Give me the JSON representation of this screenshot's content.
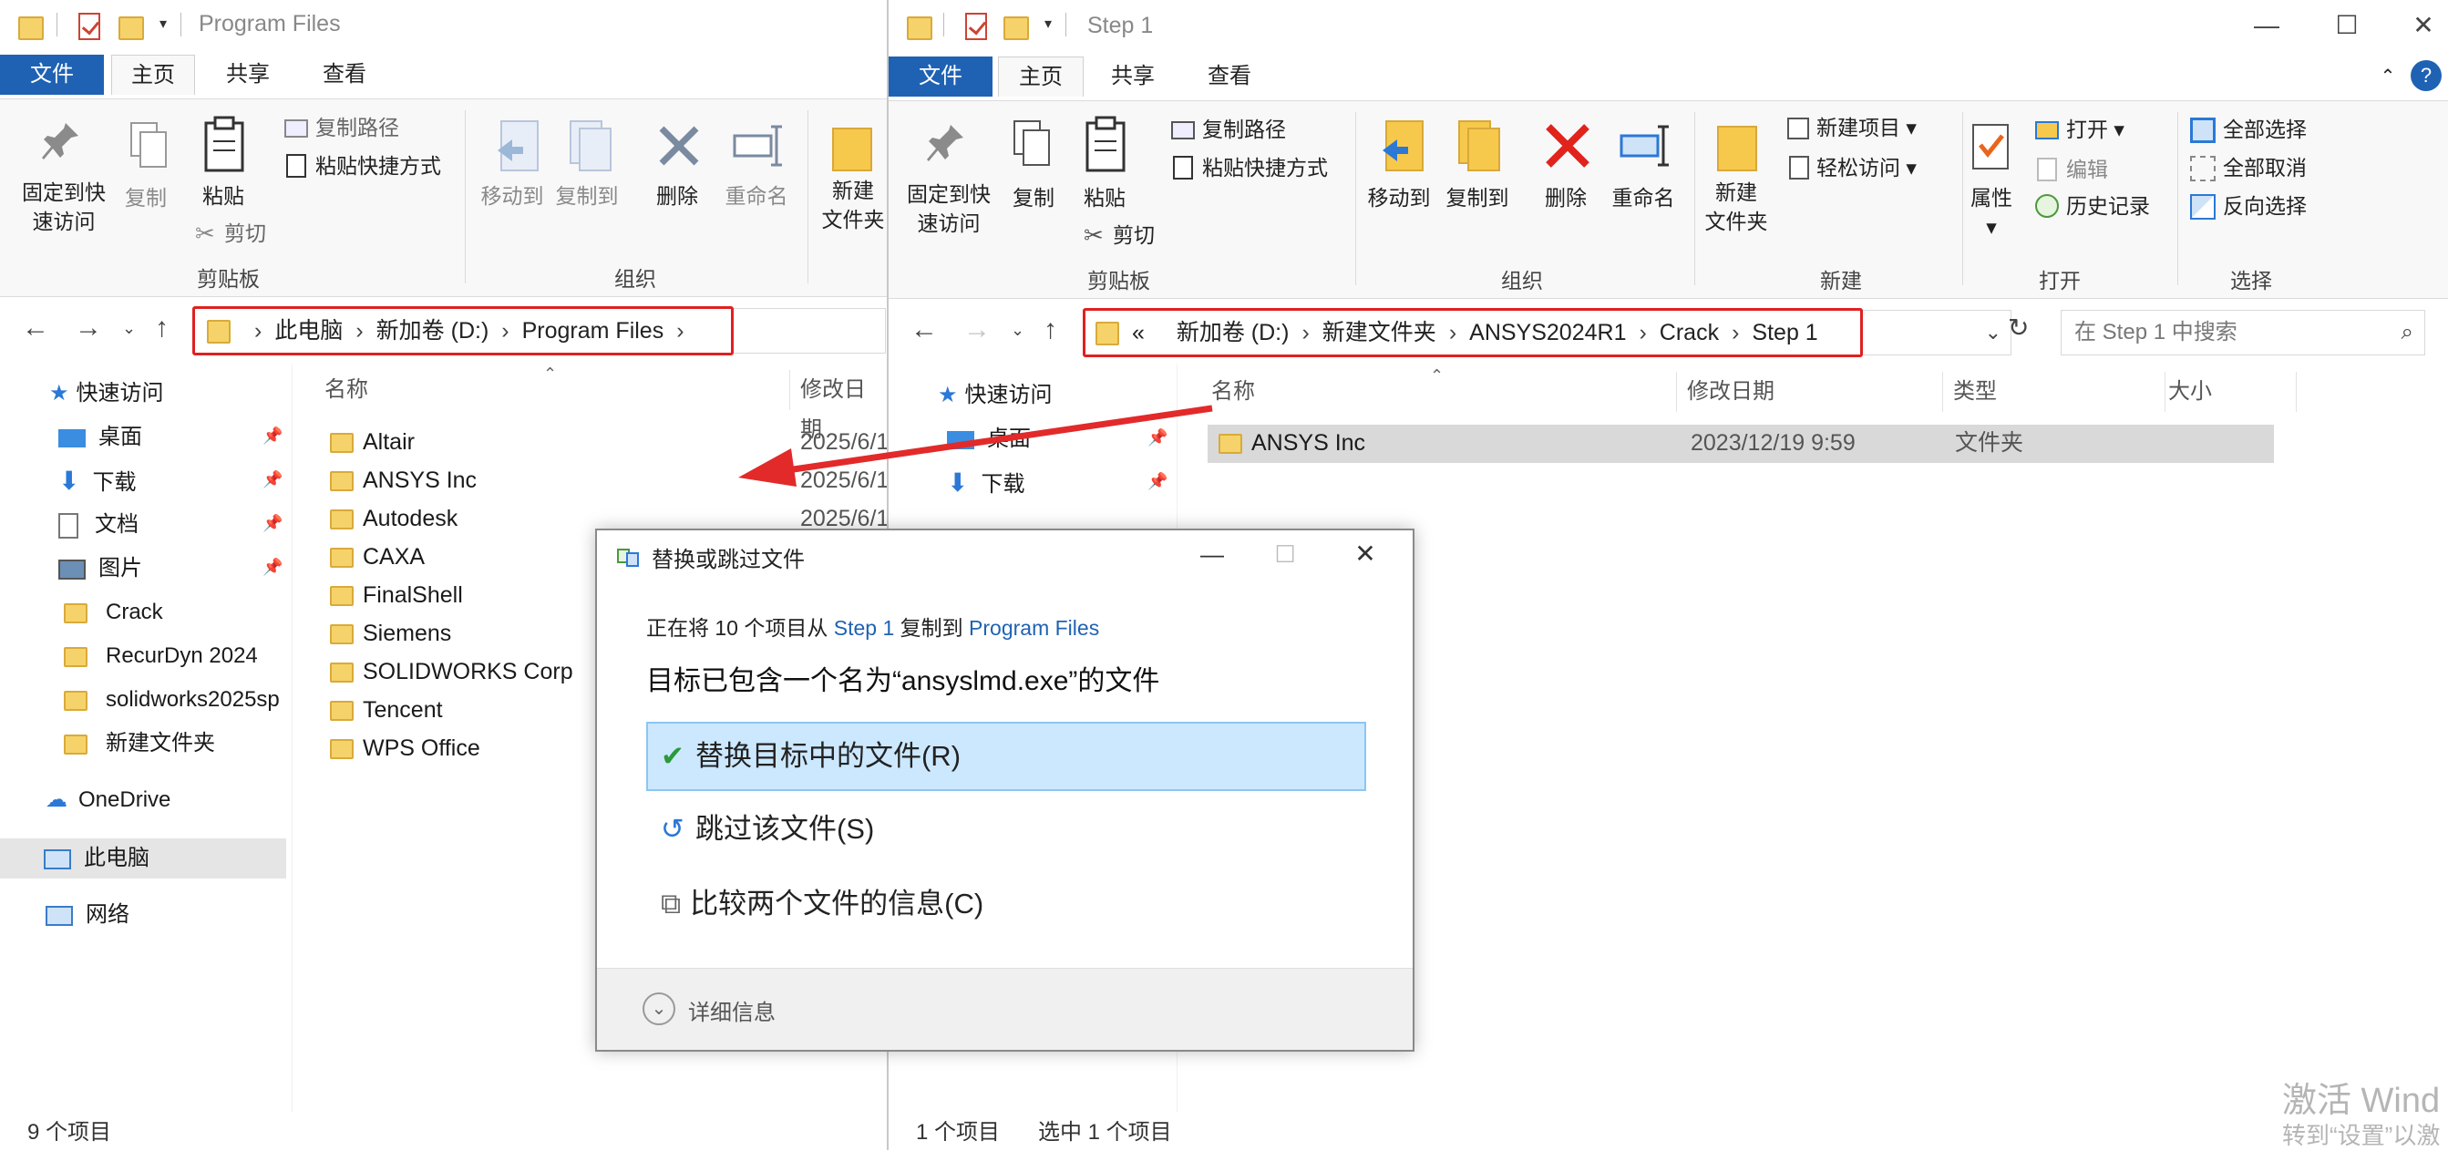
{
  "left_window": {
    "title": "Program Files",
    "tabs": [
      "文件",
      "主页",
      "共享",
      "查看"
    ],
    "ribbon": {
      "pin": "固定到快\n速访问",
      "copy": "复制",
      "paste": "粘贴",
      "copy_path": "复制路径",
      "paste_shortcut": "粘贴快捷方式",
      "cut": "剪切",
      "clipboard_group": "剪贴板",
      "move_to": "移动到",
      "copy_to": "复制到",
      "delete": "删除",
      "rename": "重命名",
      "organize_group": "组织",
      "new_folder": "新建\n文件夹"
    },
    "breadcrumb": [
      "此电脑",
      "新加卷 (D:)",
      "Program Files"
    ],
    "nav": {
      "quick_access": "快速访问",
      "items": [
        "桌面",
        "下载",
        "文档",
        "图片",
        "Crack",
        "RecurDyn 2024",
        "solidworks2025sp",
        "新建文件夹"
      ],
      "onedrive": "OneDrive",
      "this_pc": "此电脑",
      "network": "网络"
    },
    "columns": [
      "名称",
      "修改日期"
    ],
    "files": [
      {
        "name": "Altair",
        "date": "2025/6/1"
      },
      {
        "name": "ANSYS Inc",
        "date": "2025/6/1"
      },
      {
        "name": "Autodesk",
        "date": "2025/6/1"
      },
      {
        "name": "CAXA",
        "date": ""
      },
      {
        "name": "FinalShell",
        "date": ""
      },
      {
        "name": "Siemens",
        "date": ""
      },
      {
        "name": "SOLIDWORKS Corp",
        "date": ""
      },
      {
        "name": "Tencent",
        "date": ""
      },
      {
        "name": "WPS Office",
        "date": ""
      }
    ],
    "status": "9 个项目"
  },
  "right_window": {
    "title": "Step 1",
    "tabs": [
      "文件",
      "主页",
      "共享",
      "查看"
    ],
    "ribbon": {
      "pin": "固定到快\n速访问",
      "copy": "复制",
      "paste": "粘贴",
      "copy_path": "复制路径",
      "paste_shortcut": "粘贴快捷方式",
      "cut": "剪切",
      "clipboard_group": "剪贴板",
      "move_to": "移动到",
      "copy_to": "复制到",
      "delete": "删除",
      "rename": "重命名",
      "organize_group": "组织",
      "new_folder": "新建\n文件夹",
      "new_item": "新建项目",
      "easy_access": "轻松访问",
      "new_group": "新建",
      "properties": "属性",
      "open": "打开",
      "edit": "编辑",
      "history": "历史记录",
      "open_group": "打开",
      "select_all": "全部选择",
      "select_none": "全部取消",
      "invert_select": "反向选择",
      "select_group": "选择"
    },
    "breadcrumb_prefix": "«",
    "breadcrumb": [
      "新加卷 (D:)",
      "新建文件夹",
      "ANSYS2024R1",
      "Crack",
      "Step 1"
    ],
    "search_placeholder": "在 Step 1 中搜索",
    "nav": {
      "quick_access": "快速访问",
      "items": [
        "桌面",
        "下载"
      ]
    },
    "columns": [
      "名称",
      "修改日期",
      "类型",
      "大小"
    ],
    "files": [
      {
        "name": "ANSYS Inc",
        "date": "2023/12/19 9:59",
        "type": "文件夹",
        "size": ""
      }
    ],
    "status_count": "1 个项目",
    "status_selected": "选中 1 个项目"
  },
  "dialog": {
    "title": "替换或跳过文件",
    "line1_prefix": "正在将 10 个项目从 ",
    "line1_src": "Step 1",
    "line1_mid": " 复制到 ",
    "line1_dst": "Program Files",
    "line2": "目标已包含一个名为“ansyslmd.exe”的文件",
    "options": [
      "替换目标中的文件(R)",
      "跳过该文件(S)",
      "比较两个文件的信息(C)"
    ],
    "details": "详细信息"
  },
  "watermark": {
    "line1": "激活 Wind",
    "line2": "转到“设置”以激"
  },
  "colors": {
    "file_tab": "#1f62b4",
    "highlight_red": "#e02020",
    "selected_bg": "#cce8ff",
    "folder_yellow": "#f6d36a"
  }
}
